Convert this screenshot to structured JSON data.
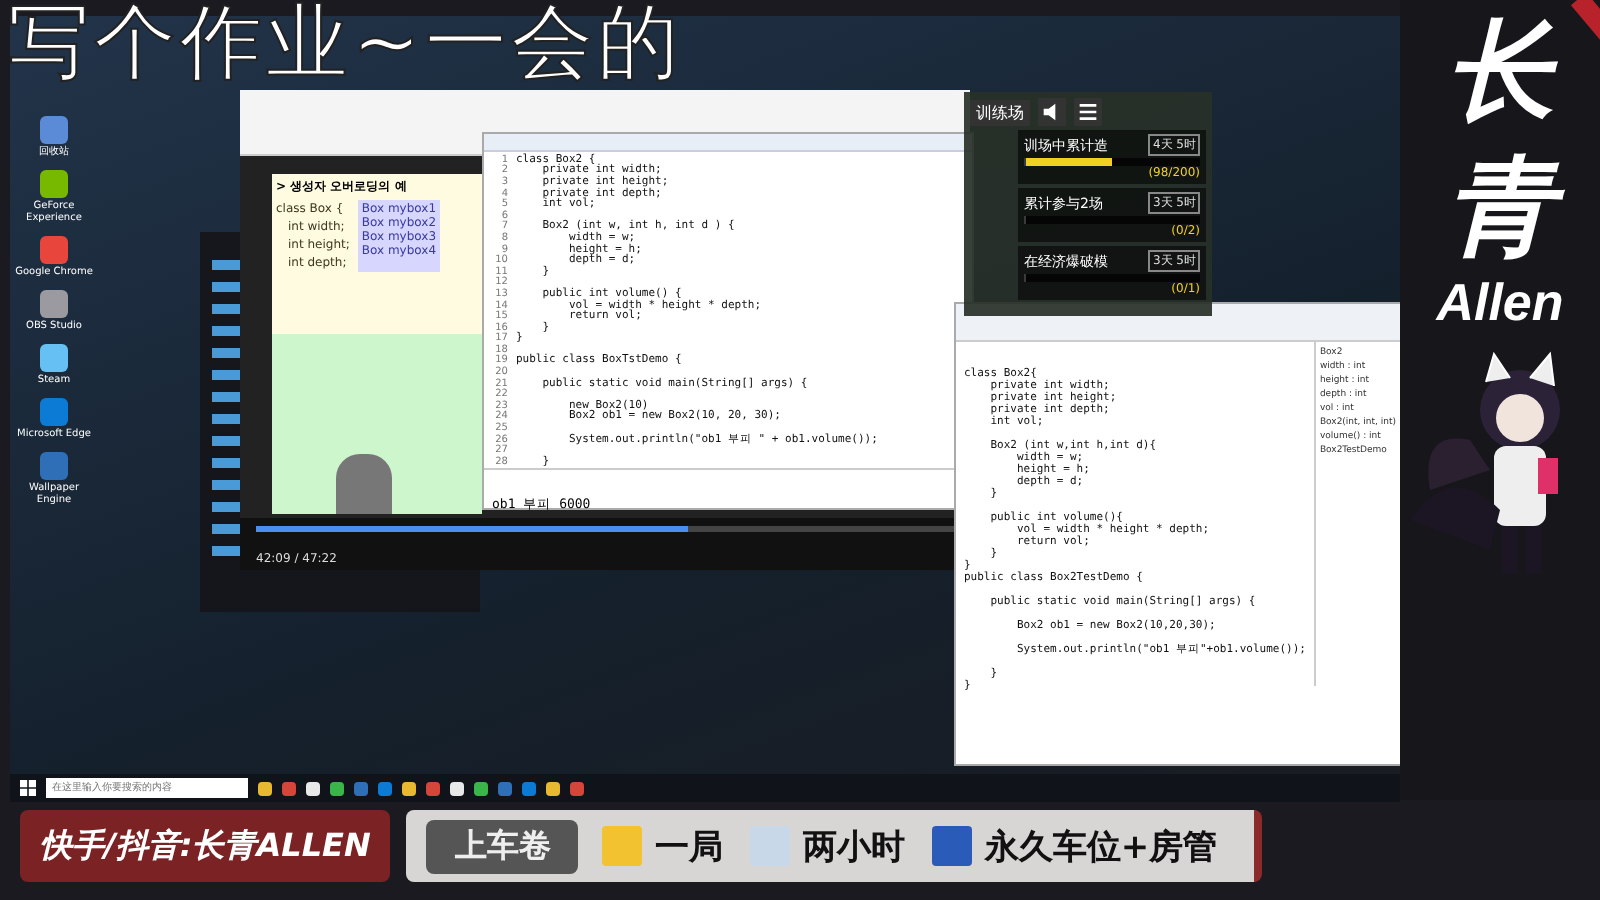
{
  "overlay_title": "写个作业~一会的",
  "desktop_icons": [
    "回收站",
    "GeForce Experience",
    "Google Chrome",
    "OBS Studio",
    "Steam",
    "Microsoft Edge",
    "Wallpaper Engine"
  ],
  "slide_window": {
    "heading": "> 생성자 오버로딩의 예",
    "code": [
      "class  Box {",
      "int width;",
      "int height;",
      "int depth;"
    ],
    "calls": [
      "Box  mybox1",
      "Box  mybox2",
      "Box  mybox3",
      "Box  mybox4"
    ],
    "time": "42:09 / 47:22",
    "progress": {
      "level": 0.62
    }
  },
  "editor": {
    "lines": [
      {
        "n": "1",
        "text": "class Box2 {"
      },
      {
        "n": "2",
        "text": "    private int width;"
      },
      {
        "n": "3",
        "text": "    private int height;"
      },
      {
        "n": "4",
        "text": "    private int depth;"
      },
      {
        "n": "5",
        "text": "    int vol;"
      },
      {
        "n": "6"
      },
      {
        "n": "7",
        "text": "    Box2 (int w, int h, int d ) {"
      },
      {
        "n": "8",
        "text": "        width = w;"
      },
      {
        "n": "9",
        "text": "        height = h;"
      },
      {
        "n": "10",
        "text": "        depth = d;"
      },
      {
        "n": "11",
        "text": "    }"
      },
      {
        "n": "12"
      },
      {
        "n": "13",
        "text": "    public int volume() {"
      },
      {
        "n": "14",
        "text": "        vol = width * height * depth;"
      },
      {
        "n": "15",
        "text": "        return vol;"
      },
      {
        "n": "16",
        "text": "    }"
      },
      {
        "n": "17",
        "text": "}"
      },
      {
        "n": "18"
      },
      {
        "n": "19",
        "text": "public class BoxTstDemo {"
      },
      {
        "n": "20"
      },
      {
        "n": "21",
        "text": "    public static void main(String[] args) {"
      },
      {
        "n": "22"
      },
      {
        "n": "23",
        "text": "        new Box2(10)"
      },
      {
        "n": "24",
        "text": "        Box2 ob1 = new Box2(10, 20, 30);"
      },
      {
        "n": "25"
      },
      {
        "n": "26",
        "text": "        System.out.println(\"ob1 부피 \" + ob1.volume());"
      },
      {
        "n": "27"
      },
      {
        "n": "28",
        "text": "    }"
      }
    ],
    "console": "ob1 부피 6000"
  },
  "game": {
    "title": "训练场",
    "tasks": [
      {
        "name": "训场中累计造",
        "badge": "4天 5时",
        "count": "(98/200)",
        "level": 0.49
      },
      {
        "name": "累计参与2场",
        "badge": "3天 5时",
        "count": "(0/2)",
        "level": 0
      },
      {
        "name": "在经济爆破模",
        "badge": "3天 5时",
        "count": "(0/1)",
        "level": 0
      }
    ]
  },
  "editor2": {
    "blocks": [
      [
        "class Box2{",
        "    private int width;",
        "    private int height;",
        "    private int depth;",
        "    int vol;"
      ],
      [
        "    Box2 (int w,int h,int d){",
        "        width = w;",
        "        height = h;",
        "        depth = d;",
        "    }"
      ],
      [
        "    public int volume(){",
        "        vol = width * height * depth;",
        "        return vol;",
        "    }",
        "}",
        "public class Box2TestDemo {"
      ],
      [
        "    public static void main(String[] args) {"
      ],
      [
        "        Box2 ob1 = new Box2(10,20,30);"
      ],
      [
        "        System.out.println(\"ob1 부피\"+ob1.volume());"
      ],
      [
        "    }",
        "}"
      ]
    ],
    "outline": [
      "Box2",
      "width : int",
      "height : int",
      "depth : int",
      "vol : int",
      "Box2(int, int, int)",
      "volume() : int",
      "Box2TestDemo"
    ]
  },
  "taskbar": {
    "search_placeholder": "在这里输入你要搜索的内容"
  },
  "streamer": {
    "name_top": "长",
    "name_bottom": "青",
    "name_latin": "Allen"
  },
  "banner": {
    "platform": "快手/抖音:长青ALLEN",
    "label": "上车卷",
    "rewards": [
      "一局",
      "两小时",
      "永久车位+房管"
    ]
  }
}
